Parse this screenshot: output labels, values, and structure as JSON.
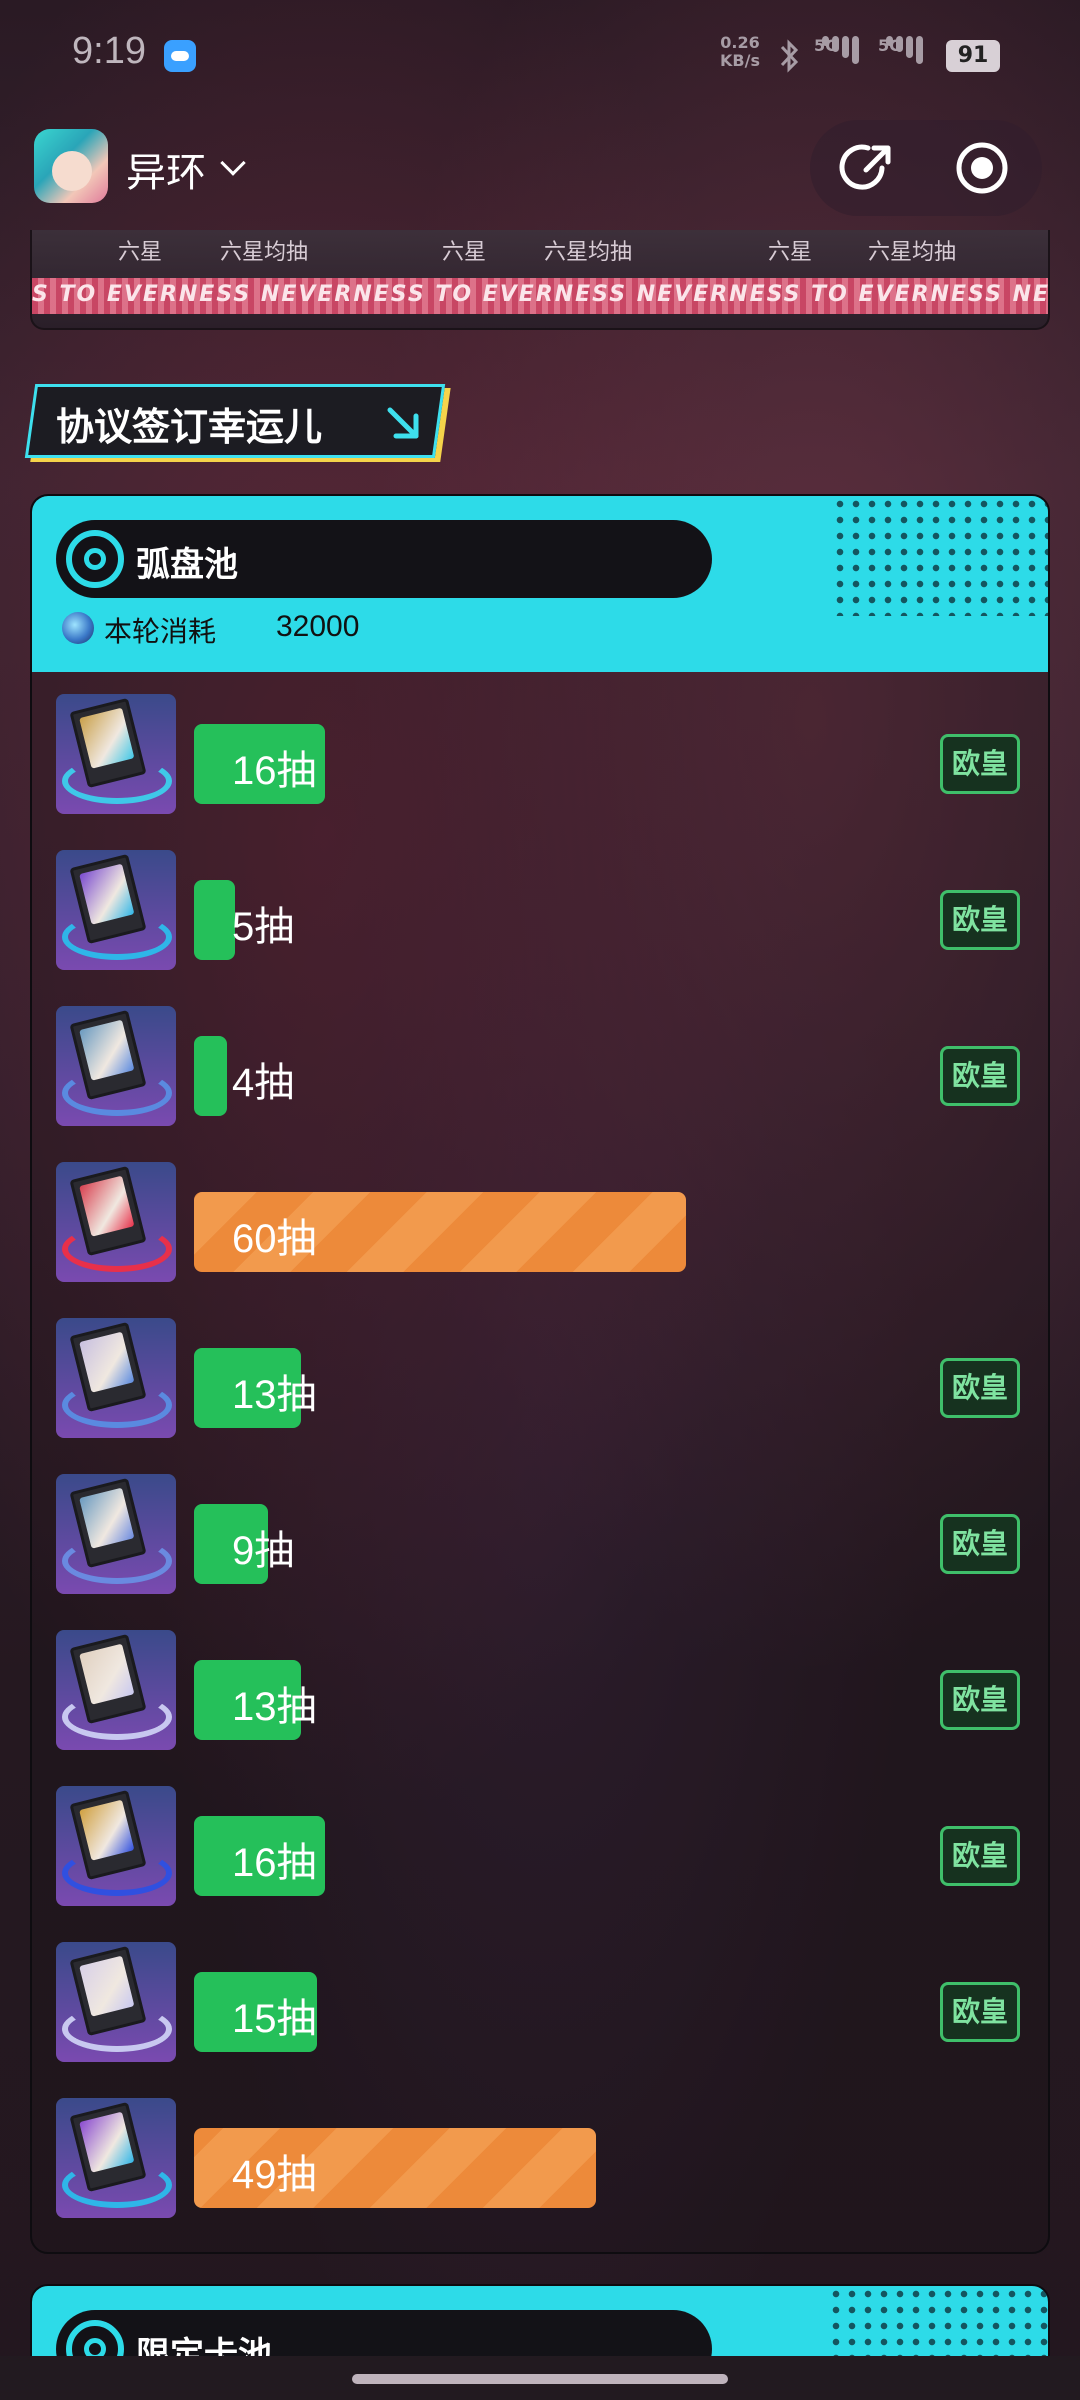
{
  "status_bar": {
    "time": "9:19",
    "net_speed_value": "0.26",
    "net_speed_unit": "KB/s",
    "signal_1": "5G",
    "signal_2": "5G",
    "battery": "91"
  },
  "header": {
    "app_name": "异环"
  },
  "prev_strip": {
    "labels": [
      "六星",
      "六星均抽",
      "六星",
      "六星均抽",
      "六星",
      "六星均抽"
    ],
    "ribbon_text": "S TO EVERNESS  NEVERNESS TO EVERNESS  NEVERNESS TO EVERNESS  NEVERNESS"
  },
  "section": {
    "title": "协议签订幸运儿"
  },
  "pool": {
    "name": "弧盘池",
    "cost_label": "本轮消耗",
    "cost_value": "32000",
    "rows": [
      {
        "pulls": 16,
        "label": "16抽",
        "type": "green",
        "badge": "欧皇",
        "colors": [
          "#c9a04a",
          "#3fc8e8"
        ]
      },
      {
        "pulls": 5,
        "label": "5抽",
        "type": "green",
        "badge": "欧皇",
        "colors": [
          "#7a4ad0",
          "#2fb6e8"
        ]
      },
      {
        "pulls": 4,
        "label": "4抽",
        "type": "green",
        "badge": "欧皇",
        "colors": [
          "#6a9ac0",
          "#5a8ae0"
        ]
      },
      {
        "pulls": 60,
        "label": "60抽",
        "type": "orange",
        "badge": "",
        "colors": [
          "#d84050",
          "#e8304a"
        ]
      },
      {
        "pulls": 13,
        "label": "13抽",
        "type": "green",
        "badge": "欧皇",
        "colors": [
          "#c8c0e0",
          "#5a8ae0"
        ]
      },
      {
        "pulls": 9,
        "label": "9抽",
        "type": "green",
        "badge": "欧皇",
        "colors": [
          "#6a9ac0",
          "#6a8ae0"
        ]
      },
      {
        "pulls": 13,
        "label": "13抽",
        "type": "green",
        "badge": "欧皇",
        "colors": [
          "#e0d0c0",
          "#c8c8f0"
        ]
      },
      {
        "pulls": 16,
        "label": "16抽",
        "type": "green",
        "badge": "欧皇",
        "colors": [
          "#d0a040",
          "#3050e0"
        ]
      },
      {
        "pulls": 15,
        "label": "15抽",
        "type": "green",
        "badge": "欧皇",
        "colors": [
          "#d8d0e8",
          "#c8c8f0"
        ]
      },
      {
        "pulls": 49,
        "label": "49抽",
        "type": "orange",
        "badge": "",
        "colors": [
          "#8a4ad0",
          "#2fb6e8"
        ]
      }
    ]
  },
  "next_pool": {
    "name": "限定卡池"
  },
  "colors": {
    "accent": "#2ddbe8",
    "green": "#25c05a",
    "orange": "#ed8a3a",
    "badge_border": "#3fbf6a"
  }
}
